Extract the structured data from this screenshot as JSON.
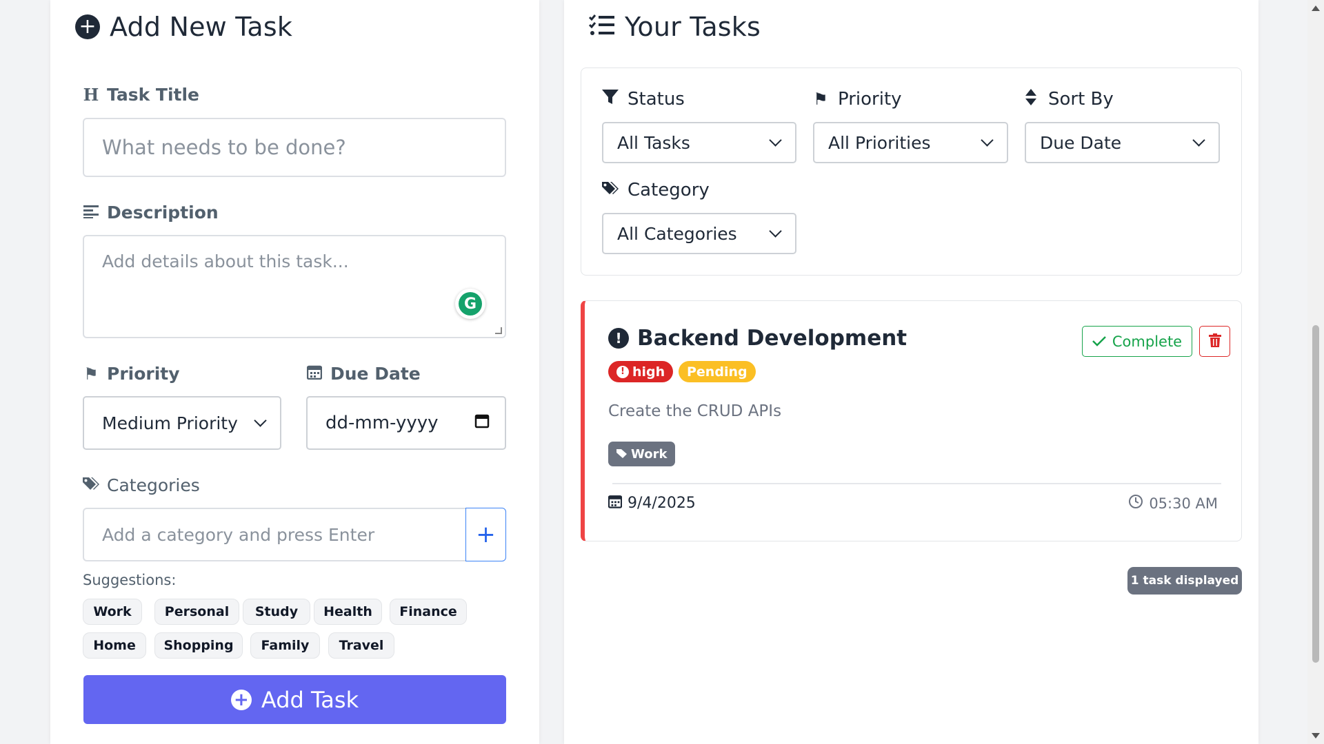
{
  "add_form": {
    "heading": "Add New Task",
    "title_label": "Task Title",
    "title_placeholder": "What needs to be done?",
    "description_label": "Description",
    "description_placeholder": "Add details about this task...",
    "priority_label": "Priority",
    "priority_value": "Medium Priority",
    "due_date_label": "Due Date",
    "due_date_placeholder": "dd-mm-yyyy",
    "categories_label": "Categories",
    "category_placeholder": "Add a category and press Enter",
    "add_category_symbol": "+",
    "suggestions_label": "Suggestions:",
    "suggestions": [
      "Work",
      "Personal",
      "Study",
      "Health",
      "Finance",
      "Home",
      "Shopping",
      "Family",
      "Travel"
    ],
    "submit_label": "Add Task"
  },
  "task_list": {
    "heading": "Your Tasks",
    "filters": {
      "status_label": "Status",
      "status_value": "All Tasks",
      "priority_label": "Priority",
      "priority_value": "All Priorities",
      "sort_label": "Sort By",
      "sort_value": "Due Date",
      "category_label": "Category",
      "category_value": "All Categories"
    },
    "tasks": [
      {
        "title": "Backend Development",
        "priority": "high",
        "status": "Pending",
        "description": "Create the CRUD APIs",
        "category": "Work",
        "date": "9/4/2025",
        "time": "05:30 AM",
        "complete_label": "Complete"
      }
    ],
    "count_label": "1 task displayed"
  },
  "colors": {
    "accent": "#6366f1",
    "high_priority": "#dc2626",
    "pending": "#fbbf24",
    "complete": "#16a34a",
    "grammarly": "#15a26b"
  }
}
